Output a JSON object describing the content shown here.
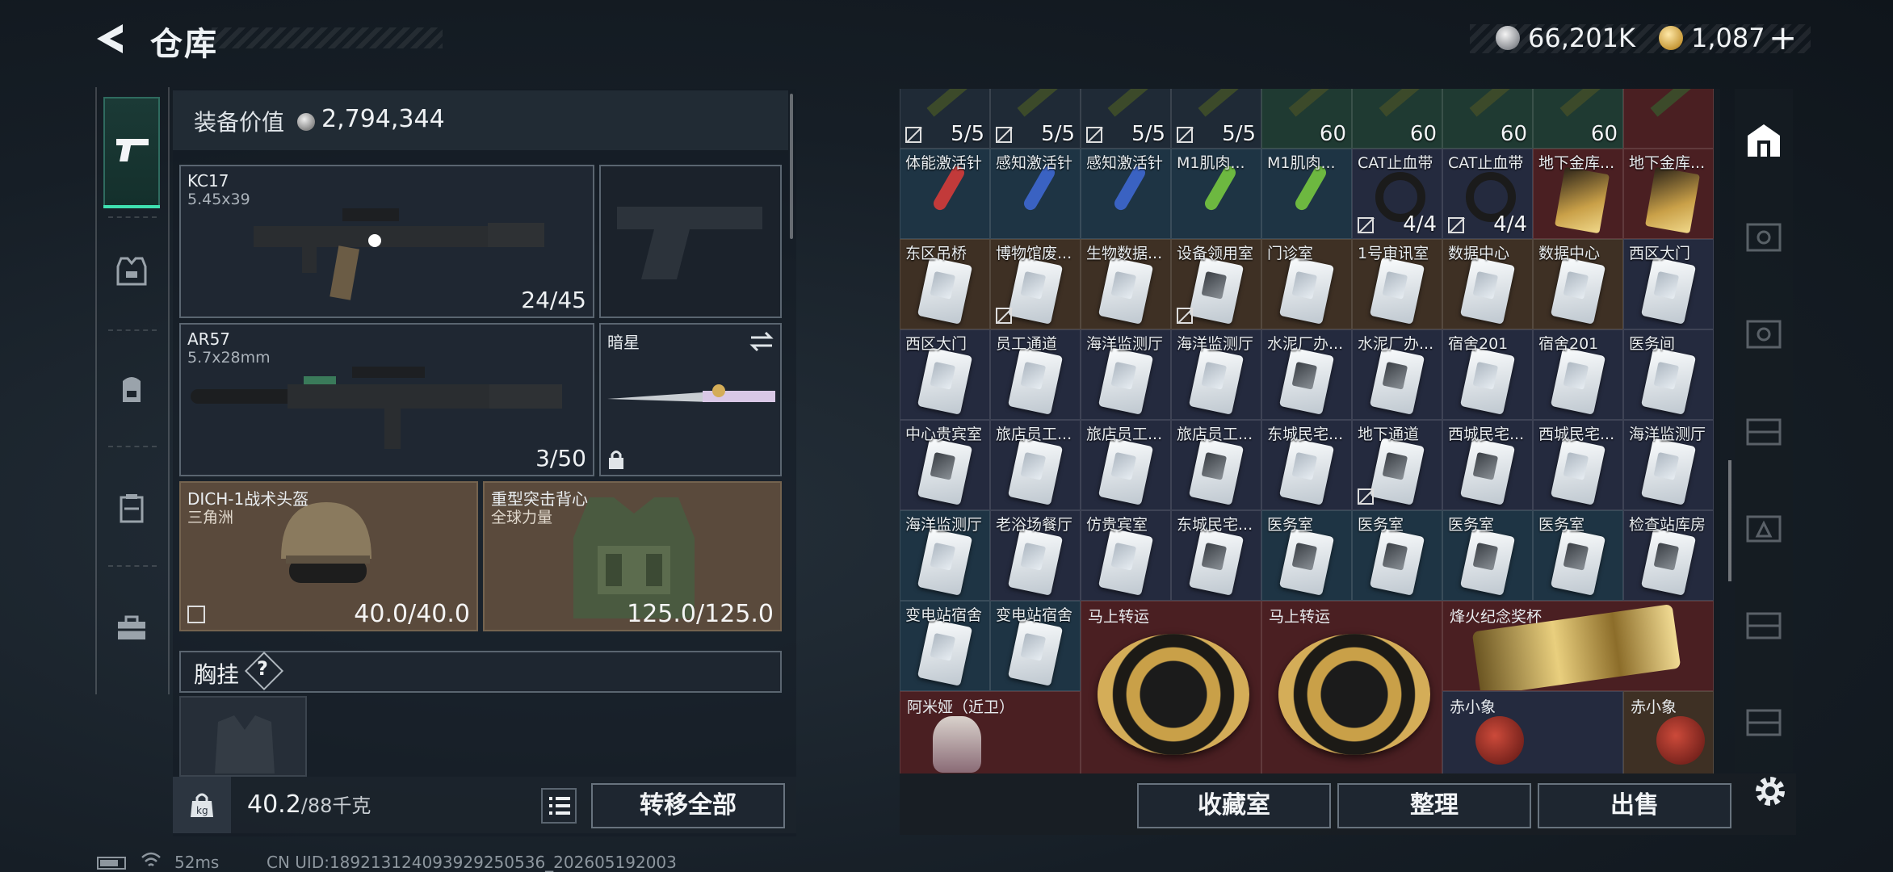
{
  "header": {
    "title": "仓库",
    "silver": "66,201K",
    "gold": "1,087",
    "plus": "+"
  },
  "equipment": {
    "value_label": "装备价值",
    "value": "2,794,344",
    "primary": {
      "name": "KC17",
      "caliber": "5.45x39",
      "ammo": "24/45"
    },
    "secondary": {
      "name": "AR57",
      "caliber": "5.7x28mm",
      "ammo": "3/50"
    },
    "melee": {
      "name": "暗星"
    },
    "helmet": {
      "name": "DICH-1战术头盔",
      "sub": "三角洲",
      "durability": "40.0/40.0"
    },
    "armor": {
      "name": "重型突击背心",
      "sub": "全球力量",
      "durability": "125.0/125.0"
    },
    "chest_label": "胸挂",
    "chest_help": "?"
  },
  "footer": {
    "weight": "40.2",
    "capacity": "/88千克",
    "transfer_all": "转移全部"
  },
  "actions": {
    "collection": "收藏室",
    "organize": "整理",
    "sell": "出售"
  },
  "status": {
    "ping": "52ms",
    "uid": "CN UID:18921312409392925053​6_202605192003"
  },
  "grid": {
    "row0": [
      "5/5",
      "5/5",
      "5/5",
      "5/5",
      "60",
      "60",
      "60",
      "60",
      ""
    ],
    "row1": [
      "体能激活针",
      "感知激活针",
      "感知激活针",
      "M1肌肉...",
      "M1肌肉...",
      "CAT止血带",
      "CAT止血带",
      "地下金库...",
      "地下金库..."
    ],
    "row1_counts": [
      "",
      "",
      "",
      "",
      "",
      "4/4",
      "4/4",
      "",
      ""
    ],
    "row2": [
      "东区吊桥",
      "博物馆废...",
      "生物数据...",
      "设备领用室",
      "门诊室",
      "1号审讯室",
      "数据中心",
      "数据中心",
      "西区大门"
    ],
    "row3": [
      "西区大门",
      "员工通道",
      "海洋监测厅",
      "海洋监测厅",
      "水泥厂办...",
      "水泥厂办...",
      "宿舍201",
      "宿舍201",
      "医务间"
    ],
    "row4": [
      "中心贵宾室",
      "旅店员工...",
      "旅店员工...",
      "旅店员工...",
      "东城民宅...",
      "地下通道",
      "西城民宅...",
      "西城民宅...",
      "海洋监测厅"
    ],
    "row5": [
      "海洋监测厅",
      "老浴场餐厅",
      "仿贵宾室",
      "东城民宅...",
      "医务室",
      "医务室",
      "医务室",
      "医务室",
      "检查站库房"
    ],
    "row6": [
      "变电站宿舍",
      "变电站宿舍"
    ],
    "big1": "马上转运",
    "big2": "马上转运",
    "big3": "烽火纪念奖杯",
    "row7": [
      "阿米娅（近卫）",
      "赤小象",
      "赤小象"
    ]
  }
}
